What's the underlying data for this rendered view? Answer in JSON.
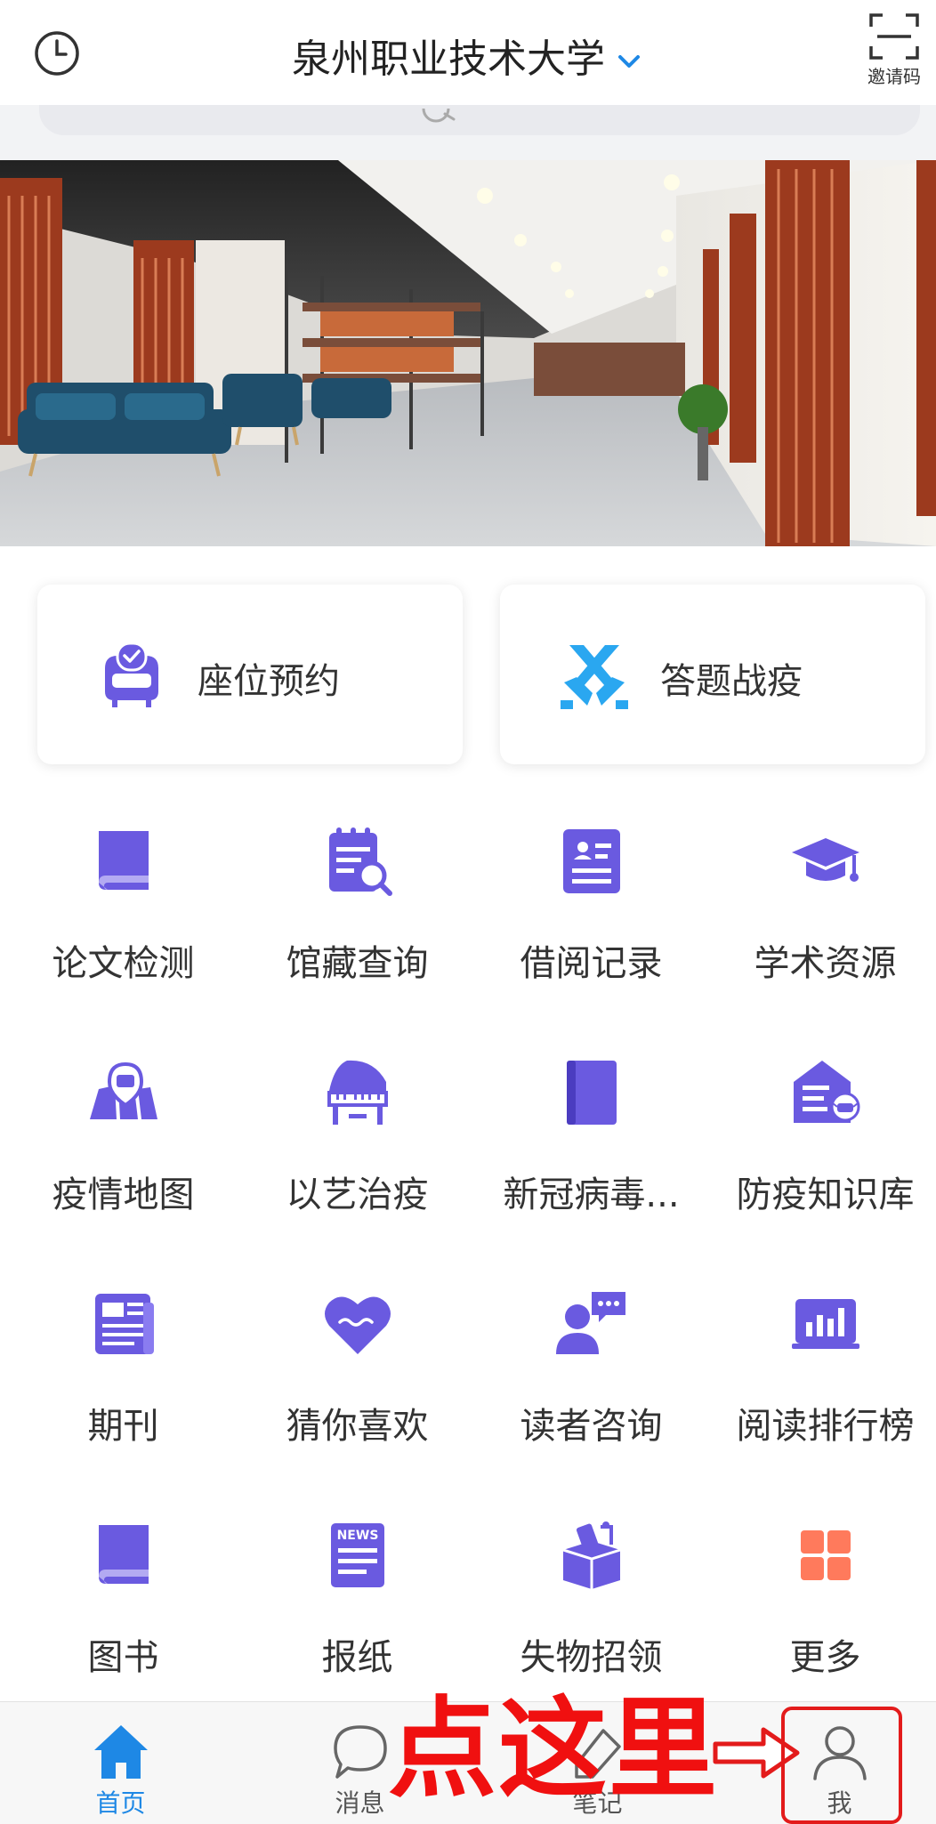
{
  "header": {
    "title": "泉州职业技术大学",
    "invite_label": "邀请码"
  },
  "cards": [
    {
      "label": "座位预约",
      "icon": "seat-reservation-icon"
    },
    {
      "label": "答题战疫",
      "icon": "crossed-swords-icon"
    }
  ],
  "grid": [
    {
      "label": "论文检测",
      "icon": "book-icon"
    },
    {
      "label": "馆藏查询",
      "icon": "catalog-search-icon"
    },
    {
      "label": "借阅记录",
      "icon": "borrow-record-icon"
    },
    {
      "label": "学术资源",
      "icon": "graduation-cap-icon"
    },
    {
      "label": "疫情地图",
      "icon": "epidemic-map-icon"
    },
    {
      "label": "以艺治疫",
      "icon": "piano-icon"
    },
    {
      "label": "新冠病毒...",
      "icon": "notebook-icon"
    },
    {
      "label": "防疫知识库",
      "icon": "knowledge-base-icon"
    },
    {
      "label": "期刊",
      "icon": "journal-icon"
    },
    {
      "label": "猜你喜欢",
      "icon": "heart-icon"
    },
    {
      "label": "读者咨询",
      "icon": "consult-icon"
    },
    {
      "label": "阅读排行榜",
      "icon": "ranking-chart-icon"
    },
    {
      "label": "图书",
      "icon": "books-icon"
    },
    {
      "label": "报纸",
      "icon": "newspaper-icon"
    },
    {
      "label": "失物招领",
      "icon": "lost-found-box-icon"
    },
    {
      "label": "更多",
      "icon": "more-grid-icon"
    }
  ],
  "icon_badge_text": {
    "newspaper": "NEWS"
  },
  "tabs": [
    {
      "label": "首页",
      "icon": "home-icon",
      "active": true
    },
    {
      "label": "消息",
      "icon": "chat-bubble-icon",
      "active": false
    },
    {
      "label": "笔记",
      "icon": "note-icon",
      "active": false
    },
    {
      "label": "我",
      "icon": "person-icon",
      "active": false
    }
  ],
  "annotation": {
    "text": "点这里"
  },
  "colors": {
    "accent": "#6a5ae0",
    "accent_blue": "#2aa7f0",
    "tab_active": "#1e88e5",
    "more_tiles": "#ff7a5c",
    "annotation_red": "#e31b1b"
  }
}
